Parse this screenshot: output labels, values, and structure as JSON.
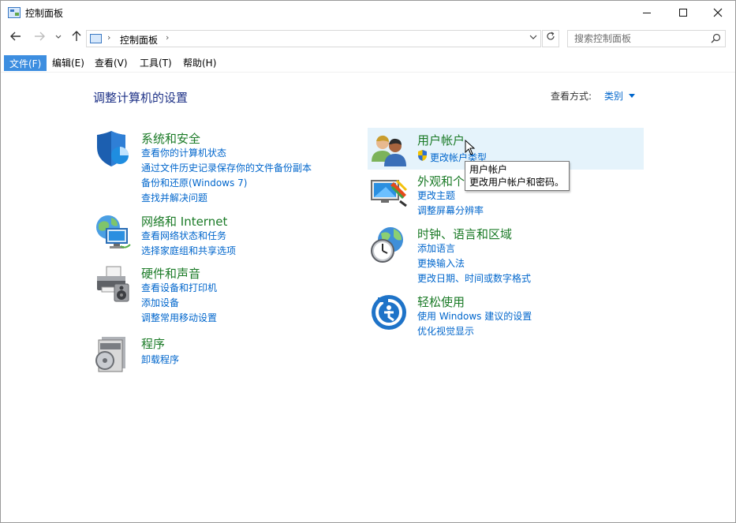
{
  "window": {
    "title": "控制面板"
  },
  "address": {
    "crumb": "控制面板",
    "search_placeholder": "搜索控制面板"
  },
  "menu": [
    {
      "label": "文件(F)"
    },
    {
      "label": "编辑(E)"
    },
    {
      "label": "查看(V)"
    },
    {
      "label": "工具(T)"
    },
    {
      "label": "帮助(H)"
    }
  ],
  "main": {
    "heading": "调整计算机的设置",
    "view_by_label": "查看方式:",
    "view_by_value": "类别"
  },
  "categories": {
    "system": {
      "title": "系统和安全",
      "links": [
        "查看你的计算机状态",
        "通过文件历史记录保存你的文件备份副本",
        "备份和还原(Windows 7)",
        "查找并解决问题"
      ]
    },
    "network": {
      "title": "网络和 Internet",
      "links": [
        "查看网络状态和任务",
        "选择家庭组和共享选项"
      ]
    },
    "hardware": {
      "title": "硬件和声音",
      "links": [
        "查看设备和打印机",
        "添加设备",
        "调整常用移动设置"
      ]
    },
    "programs": {
      "title": "程序",
      "links": [
        "卸载程序"
      ]
    },
    "users": {
      "title": "用户帐户",
      "links": [
        "更改帐户类型"
      ]
    },
    "appearance": {
      "title": "外观和个",
      "links": [
        "更改主题",
        "调整屏幕分辨率"
      ]
    },
    "clock": {
      "title": "时钟、语言和区域",
      "links": [
        "添加语言",
        "更换输入法",
        "更改日期、时间或数字格式"
      ]
    },
    "ease": {
      "title": "轻松使用",
      "links": [
        "使用 Windows 建议的设置",
        "优化视觉显示"
      ]
    }
  },
  "tooltip": {
    "line1": "用户帐户",
    "line2": "更改用户帐户和密码。"
  },
  "colors": {
    "category_title": "#1a7a26",
    "link": "#0066cc",
    "heading": "#1e3287",
    "menu_active": "#3d8ee0",
    "hover": "#e5f3fb"
  }
}
